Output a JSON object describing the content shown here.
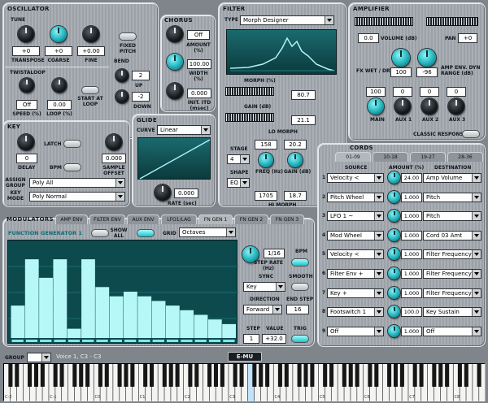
{
  "oscillator": {
    "title": "OSCILLATOR",
    "tune_label": "TUNE",
    "transpose_value": "+0",
    "transpose_label": "TRANSPOSE",
    "coarse_value": "+0",
    "coarse_label": "COARSE",
    "fine_value": "+0.00",
    "fine_label": "FINE",
    "fixed_pitch_label": "FIXED PITCH",
    "twistaloop_label": "TWISTALOOP",
    "speed_value": "Off",
    "speed_label": "SPEED (%)",
    "loop_value": "0.00",
    "loop_label": "LOOP (%)",
    "start_at_loop_label": "START AT LOOP",
    "bend_label": "BEND",
    "bend_up_value": "2",
    "bend_up_label": "UP",
    "bend_down_value": "-2",
    "bend_down_label": "DOWN"
  },
  "chorus": {
    "title": "CHORUS",
    "off_value": "Off",
    "amount_label": "AMOUNT (%)",
    "width_value": "100.00",
    "width_label": "WIDTH (%)",
    "init_itd_value": "0.000",
    "init_itd_label": "INIT. ITD (msec)"
  },
  "key": {
    "title": "KEY",
    "latch_label": "LATCH",
    "delay_value": "0",
    "delay_label": "DELAY",
    "bpm_label": "BPM",
    "sample_offset_value": "0.000",
    "sample_offset_label": "SAMPLE OFFSET",
    "assign_group_label": "ASSIGN GROUP",
    "assign_group_value": "Poly All",
    "key_mode_label": "KEY MODE",
    "key_mode_value": "Poly Normal"
  },
  "glide": {
    "title": "GLIDE",
    "curve_label": "CURVE",
    "curve_value": "Linear",
    "rate_value": "0.000",
    "rate_label": "RATE (sec)"
  },
  "filter": {
    "title": "FILTER",
    "type_label": "TYPE",
    "type_value": "Morph Designer",
    "morph_label": "MORPH (%)",
    "morph_value": "80.7",
    "gain_label": "GAIN (dB)",
    "gain_value": "21.1",
    "lo_morph_label": "LO MORPH",
    "lo_freq_value": "158",
    "lo_gain_value": "20.2",
    "stage_label": "STAGE",
    "stage_value": "4",
    "freq_label": "FREQ (Hz)",
    "gain_db_label": "GAIN (dB)",
    "shape_label": "SHAPE",
    "shape_value": "EQ",
    "hi_freq_value": "1705",
    "hi_gain_value": "18.7",
    "hi_morph_label": "HI MORPH"
  },
  "amplifier": {
    "title": "AMPLIFIER",
    "volume_value": "0.0",
    "volume_label": "VOLUME (dB)",
    "pan_label": "PAN",
    "pan_value": "+0",
    "fx_wet_dry_label": "FX WET / DRY",
    "fx_wet_dry_value": "100",
    "amp_env_dyn_value": "-96",
    "amp_env_dyn_label": "AMP ENV. DYN RANGE (dB)",
    "main_value": "100",
    "main_label": "MAIN",
    "aux1_value": "0",
    "aux1_label": "AUX 1",
    "aux2_value": "0",
    "aux2_label": "AUX 2",
    "aux3_value": "0",
    "aux3_label": "AUX 3",
    "classic_response_label": "CLASSIC RESPONSE"
  },
  "cords": {
    "title": "CORDS",
    "tabs": [
      "01-09",
      "10-18",
      "19-27",
      "28-36"
    ],
    "col_source": "SOURCE",
    "col_amount": "AMOUNT (%)",
    "col_destination": "DESTINATION",
    "rows": [
      {
        "num": "1",
        "source": "Velocity  <",
        "amount": "24.00",
        "destination": "Amp Volume"
      },
      {
        "num": "2",
        "source": "Pitch Wheel",
        "amount": "1.000",
        "destination": "Pitch"
      },
      {
        "num": "3",
        "source": "LFO 1 ~",
        "amount": "1.000",
        "destination": "Pitch"
      },
      {
        "num": "4",
        "source": "Mod Wheel",
        "amount": "1.000",
        "destination": "Cord 03 Amt"
      },
      {
        "num": "5",
        "source": "Velocity  <",
        "amount": "1.000",
        "destination": "Filter Frequency"
      },
      {
        "num": "6",
        "source": "Filter Env  +",
        "amount": "1.000",
        "destination": "Filter Frequency"
      },
      {
        "num": "7",
        "source": "Key  +",
        "amount": "1.000",
        "destination": "Filter Frequency"
      },
      {
        "num": "8",
        "source": "Footswitch 1",
        "amount": "100.0",
        "destination": "Key Sustain"
      },
      {
        "num": "9",
        "source": "Off",
        "amount": "1.000",
        "destination": "Off"
      }
    ]
  },
  "modulators": {
    "title": "MODULATORS",
    "tabs": [
      "AMP ENV",
      "FILTER ENV",
      "AUX ENV",
      "LFO1/LAG",
      "FN GEN 1",
      "FN GEN 2",
      "FN GEN 3"
    ],
    "active_tab": "FN GEN 1",
    "fg_title": "FUNCTION GENERATOR 1",
    "show_all_label": "SHOW ALL",
    "grid_label": "GRID",
    "grid_value": "Octaves",
    "step_rate_value": "1/16",
    "step_rate_label": "STEP RATE (Hz)",
    "bpm_label": "BPM",
    "sync_label": "SYNC",
    "sync_value": "Key",
    "smooth_label": "SMOOTH",
    "direction_label": "DIRECTION",
    "direction_value": "Forward",
    "end_step_label": "END STEP",
    "end_step_value": "16",
    "step_label": "STEP",
    "step_value": "1",
    "value_label": "VALUE",
    "value_value": "+32.0",
    "trig_label": "TRIG",
    "steps": [
      0.35,
      0.85,
      0.65,
      0.85,
      0.1,
      0.85,
      0.55,
      0.45,
      0.5,
      0.45,
      0.4,
      0.35,
      0.3,
      0.25,
      0.2,
      0.15
    ]
  },
  "bottom": {
    "group_label": "GROUP",
    "voice_text": "Voice 1, C3 - C3",
    "logo_text": "E-MU",
    "octave_labels": [
      "C-2",
      "C-1",
      "C0",
      "C1",
      "C2",
      "C3",
      "C4",
      "C5",
      "C6",
      "C7",
      "C8"
    ]
  },
  "colors": {
    "accent": "#1fc1c9",
    "panel": "#a7adb3",
    "lcd": "#0c3a3d"
  }
}
